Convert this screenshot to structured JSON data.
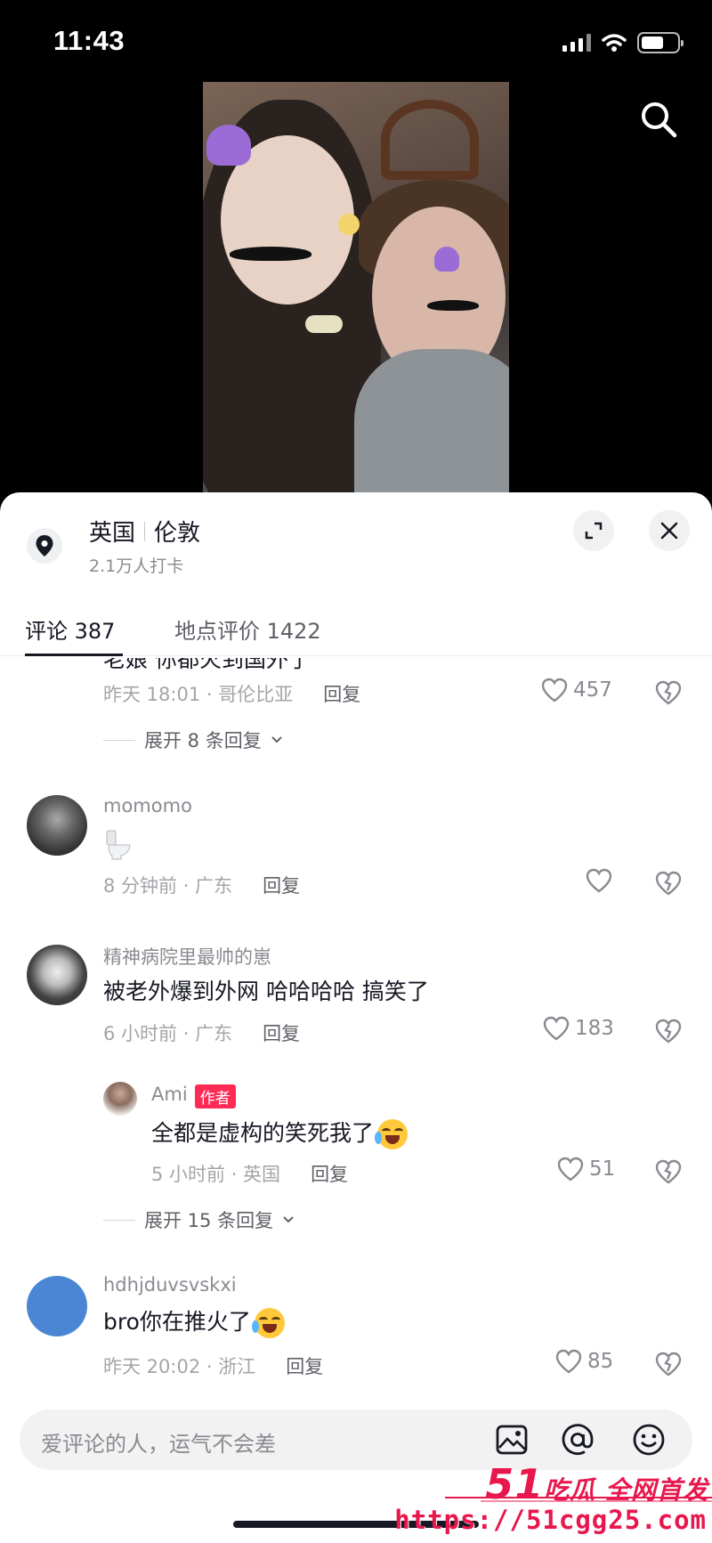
{
  "status_bar": {
    "time": "11:43"
  },
  "location": {
    "country": "英国",
    "city": "伦敦",
    "checkins": "2.1万人打卡"
  },
  "tabs": {
    "comments": "评论 387",
    "reviews": "地点评价 1422"
  },
  "comments": [
    {
      "text_partial": "老娘 你都火到国外了",
      "time": "昨天 18:01 · 哥伦比亚",
      "reply": "回复",
      "likes": "457",
      "expand": "展开 8 条回复"
    },
    {
      "username": "momomo",
      "text": "🚽",
      "time": "8 分钟前 · 广东",
      "reply": "回复",
      "likes": ""
    },
    {
      "username": "精神病院里最帅的崽",
      "text": "被老外爆到外网 哈哈哈哈 搞笑了",
      "time": "6 小时前 · 广东",
      "reply": "回复",
      "likes": "183",
      "sub_reply": {
        "username": "Ami",
        "badge": "作者",
        "text": "全都是虚构的笑死我了",
        "time": "5 小时前 · 英国",
        "reply": "回复",
        "likes": "51"
      },
      "expand": "展开 15 条回复"
    },
    {
      "username": "hdhjduvsvskxi",
      "text": "bro你在推火了",
      "time": "昨天 20:02 · 浙江",
      "reply": "回复",
      "likes": "85"
    }
  ],
  "input": {
    "placeholder": "爱评论的人，运气不会差"
  },
  "watermark": {
    "brand_num": "51",
    "brand_text": "吃瓜 全网首发",
    "url": "https://51cgg25.com"
  },
  "colors": {
    "accent": "#fe2c55",
    "watermark": "#e8174d",
    "avatar_blue": "#4a86d4"
  }
}
